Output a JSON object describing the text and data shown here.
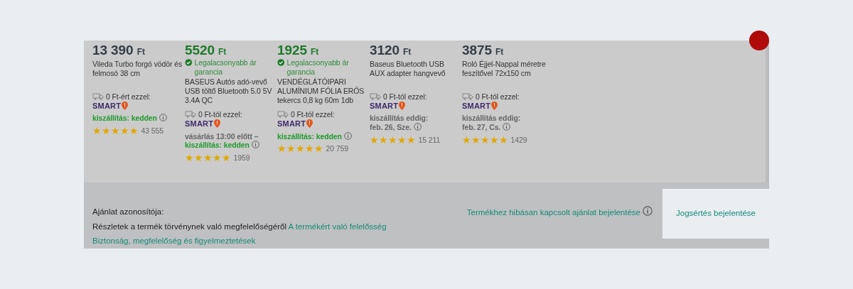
{
  "products": [
    {
      "price": "13 390",
      "currency": "Ft",
      "name": "Vileda Turbo forgó vödör és felmosó 38 cm",
      "shipping": "0 Ft-ért ezzel:",
      "logo": "SMART",
      "delivery": [
        {
          "text": "kiszállítás: kedden",
          "kind": "highlight"
        }
      ],
      "stars": 5,
      "reviews": "43 555"
    },
    {
      "price": "5520",
      "currency": "Ft",
      "guarantee": "Legalacsonyabb ár garancia",
      "name": "BASEUS Autós adó-vevő USB töltő Bluetooth 5.0 5V 3.4A QC",
      "shipping": "0 Ft-tól ezzel:",
      "logo": "SMART",
      "delivery": [
        {
          "text": "vásárlás 13:00 előtt –",
          "kind": "plain"
        },
        {
          "text": "kiszállítás: kedden",
          "kind": "highlight"
        }
      ],
      "stars": 5,
      "reviews": "1959"
    },
    {
      "price": "1925",
      "currency": "Ft",
      "guarantee": "Legalacsonyabb ár garancia",
      "name": "VENDÉGLÁTÓIPARI ALUMÍNIUM FÓLIA ERŐS tekercs 0,8 kg 60m 1db",
      "shipping": "0 Ft-tól ezzel:",
      "logo": "SMART",
      "delivery": [
        {
          "text": "kiszállítás: kedden",
          "kind": "highlight"
        }
      ],
      "stars": 5,
      "reviews": "20 759"
    },
    {
      "price": "3120",
      "currency": "Ft",
      "name": "Baseus Bluetooth USB AUX adapter hangvevő",
      "shipping": "0 Ft-tól ezzel:",
      "logo": "SMART",
      "delivery": [
        {
          "text": "kiszállítás eddig:",
          "kind": "plain"
        },
        {
          "text": "feb. 26, Sze.",
          "kind": "plain"
        }
      ],
      "stars": 5,
      "reviews": "15 211"
    },
    {
      "price": "3875",
      "currency": "Ft",
      "name": "Roló Éjjel-Nappal méretre feszítővel 72x150 cm",
      "shipping": "0 Ft-tól ezzel:",
      "logo": "SMART",
      "delivery": [
        {
          "text": "kiszállítás eddig:",
          "kind": "plain"
        },
        {
          "text": "feb. 27, Cs.",
          "kind": "plain"
        }
      ],
      "stars": 5,
      "reviews": "1429"
    }
  ],
  "footer": {
    "offer_id_label": "Ajánlat azonosítója:",
    "details_text": "Részletek a termék törvénynek való megfelelőségéről",
    "details_link": "A termékért való felelősség",
    "safety_link": "Biztonság, megfelelőség és figyelmeztetések",
    "report_link": "Termékhez hibásan kapcsolt ajánlat bejelentése",
    "infringement_link": "Jogsértés bejelentése"
  }
}
